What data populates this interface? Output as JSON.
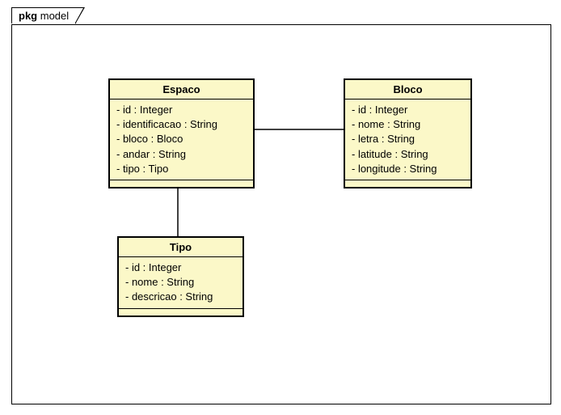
{
  "package": {
    "prefix": "pkg",
    "name": "model"
  },
  "classes": {
    "espaco": {
      "name": "Espaco",
      "attrs": [
        "- id : Integer",
        "- identificacao : String",
        "- bloco : Bloco",
        "- andar : String",
        "- tipo : Tipo"
      ]
    },
    "bloco": {
      "name": "Bloco",
      "attrs": [
        "- id : Integer",
        "- nome : String",
        "- letra : String",
        "- latitude : String",
        "- longitude : String"
      ]
    },
    "tipo": {
      "name": "Tipo",
      "attrs": [
        "- id : Integer",
        "- nome : String",
        "- descricao : String"
      ]
    }
  },
  "chart_data": {
    "type": "uml-class-diagram",
    "package": "model",
    "classes": [
      {
        "name": "Espaco",
        "attributes": [
          {
            "visibility": "-",
            "name": "id",
            "type": "Integer"
          },
          {
            "visibility": "-",
            "name": "identificacao",
            "type": "String"
          },
          {
            "visibility": "-",
            "name": "bloco",
            "type": "Bloco"
          },
          {
            "visibility": "-",
            "name": "andar",
            "type": "String"
          },
          {
            "visibility": "-",
            "name": "tipo",
            "type": "Tipo"
          }
        ]
      },
      {
        "name": "Bloco",
        "attributes": [
          {
            "visibility": "-",
            "name": "id",
            "type": "Integer"
          },
          {
            "visibility": "-",
            "name": "nome",
            "type": "String"
          },
          {
            "visibility": "-",
            "name": "letra",
            "type": "String"
          },
          {
            "visibility": "-",
            "name": "latitude",
            "type": "String"
          },
          {
            "visibility": "-",
            "name": "longitude",
            "type": "String"
          }
        ]
      },
      {
        "name": "Tipo",
        "attributes": [
          {
            "visibility": "-",
            "name": "id",
            "type": "Integer"
          },
          {
            "visibility": "-",
            "name": "nome",
            "type": "String"
          },
          {
            "visibility": "-",
            "name": "descricao",
            "type": "String"
          }
        ]
      }
    ],
    "associations": [
      {
        "from": "Espaco",
        "to": "Bloco"
      },
      {
        "from": "Espaco",
        "to": "Tipo"
      }
    ]
  }
}
